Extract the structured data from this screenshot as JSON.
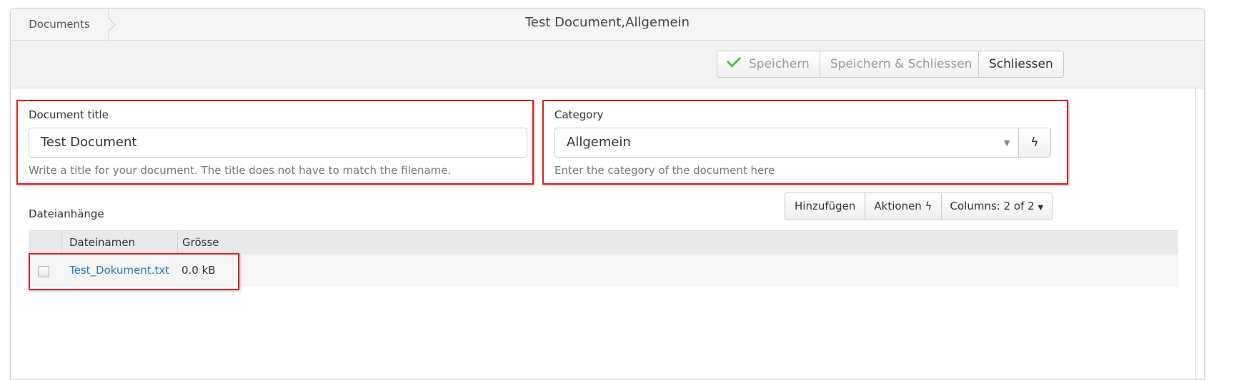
{
  "breadcrumb": {
    "label": "Documents"
  },
  "window": {
    "title": "Test Document,Allgemein"
  },
  "toolbar": {
    "save_label": "Speichern",
    "save_close_label": "Speichern & Schliessen",
    "close_label": "Schliessen"
  },
  "form": {
    "title_field": {
      "label": "Document title",
      "value": "Test Document",
      "help": "Write a title for your document. The title does not have to match the filename."
    },
    "category_field": {
      "label": "Category",
      "value": "Allgemein",
      "help": "Enter the category of the document here"
    }
  },
  "attachments": {
    "title": "Dateianhänge",
    "buttons": {
      "add": "Hinzufügen",
      "actions": "Aktionen",
      "columns": "Columns: 2 of 2"
    },
    "columns": [
      "Dateinamen",
      "Grösse"
    ],
    "rows": [
      {
        "filename": "Test_Dokument.txt",
        "size": "0.0 kB",
        "checked": false
      }
    ]
  },
  "icons": {
    "save": "check-icon",
    "quick_action": "bolt-icon",
    "dropdown": "caret-down-icon"
  },
  "colors": {
    "highlight": "#e02020",
    "link": "#2a7ab8",
    "check": "#5cb85c"
  }
}
